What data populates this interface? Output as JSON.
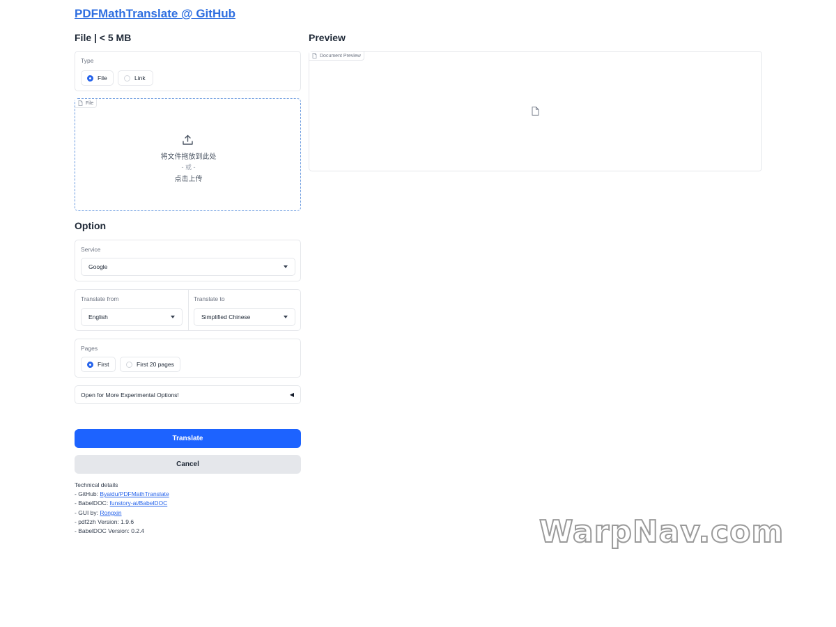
{
  "header": {
    "title": "PDFMathTranslate @ GitHub"
  },
  "file_section": {
    "title": "File | < 5 MB",
    "type_label": "Type",
    "type_options": [
      {
        "label": "File",
        "selected": true
      },
      {
        "label": "Link",
        "selected": false
      }
    ],
    "drop_zone": {
      "tag": "File",
      "line1": "将文件拖放到此处",
      "line2": "- 或 -",
      "line3": "点击上传"
    }
  },
  "preview": {
    "title": "Preview",
    "tag": "Document Preview"
  },
  "option": {
    "title": "Option",
    "service": {
      "label": "Service",
      "value": "Google"
    },
    "translate_from": {
      "label": "Translate from",
      "value": "English"
    },
    "translate_to": {
      "label": "Translate to",
      "value": "Simplified Chinese"
    },
    "pages": {
      "label": "Pages",
      "options": [
        {
          "label": "First",
          "selected": true
        },
        {
          "label": "First 20 pages",
          "selected": false
        }
      ]
    },
    "accordion": {
      "label": "Open for More Experimental Options!",
      "icon": "◀"
    }
  },
  "buttons": {
    "translate": "Translate",
    "cancel": "Cancel"
  },
  "details": {
    "heading": "Technical details",
    "github_prefix": "- GitHub: ",
    "github_link": "Byaidu/PDFMathTranslate",
    "babeldoc_prefix": "- BabelDOC: ",
    "babeldoc_link": "funstory-ai/BabelDOC",
    "gui_prefix": "- GUI by: ",
    "gui_link": "Rongxin",
    "pdf2zh_version": "- pdf2zh Version: 1.9.6",
    "babeldoc_version": "- BabelDOC Version: 0.2.4"
  },
  "watermark": {
    "text": "WarpNav.com"
  },
  "colors": {
    "accent": "#1d63ff",
    "link": "#2563eb",
    "drop_border": "#6b9be0"
  }
}
